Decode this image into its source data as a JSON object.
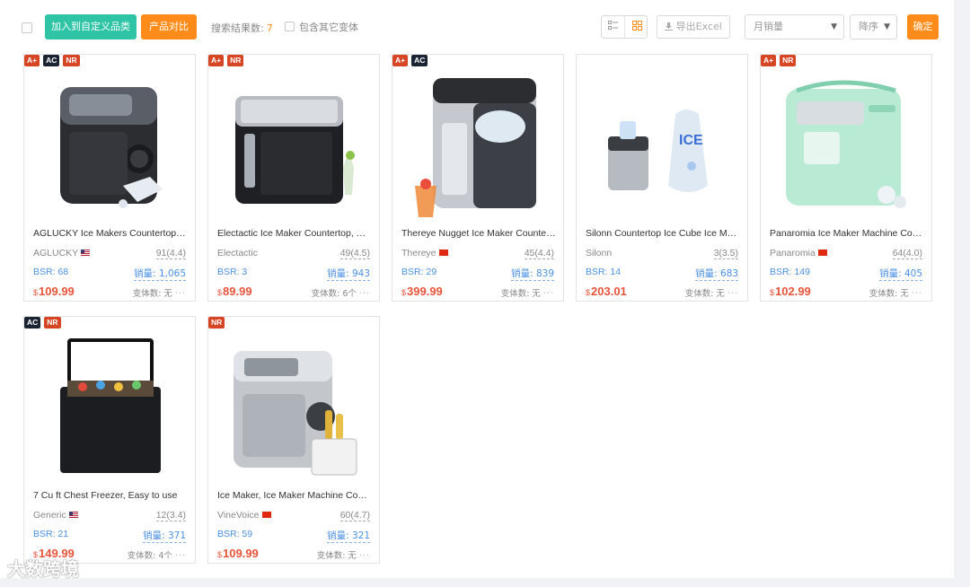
{
  "toolbar": {
    "add_category_label": "加入到自定义品类",
    "compare_label": "产品对比",
    "result_count_label": "搜索结果数:",
    "result_count": "7",
    "include_variants_label": "包含其它变体",
    "export_label": "导出Excel",
    "sort_field": "月销量",
    "sort_order": "降序",
    "confirm_label": "确定"
  },
  "products": [
    {
      "badges": [
        "A+",
        "AC",
        "NR"
      ],
      "title": "AGLUCKY Ice Makers Countertop Portable Ice Machine",
      "brand": "AGLUCKY",
      "flag": "us",
      "rating": "91(4.4)",
      "bsr": "BSR: 68",
      "sales": "销量: 1,065",
      "currency": "$",
      "price": "109.99",
      "variants": "变体数: 无"
    },
    {
      "badges": [
        "A+",
        "NR"
      ],
      "title": "Electactic Ice Maker Countertop, Portable Ice Machine",
      "brand": "Electactic",
      "flag": "",
      "rating": "49(4.5)",
      "bsr": "BSR: 3",
      "sales": "销量: 943",
      "currency": "$",
      "price": "89.99",
      "variants": "变体数: 6个"
    },
    {
      "badges": [
        "A+",
        "AC"
      ],
      "title": "Thereye Nugget Ice Maker Countertop",
      "brand": "Thereye",
      "flag": "cn",
      "rating": "45(4.4)",
      "bsr": "BSR: 29",
      "sales": "销量: 839",
      "currency": "$",
      "price": "399.99",
      "variants": "变体数: 无"
    },
    {
      "badges": [],
      "title": "Silonn Countertop Ice Cube Ice Maker",
      "brand": "Silonn",
      "flag": "",
      "rating": "3(3.5)",
      "bsr": "BSR: 14",
      "sales": "销量: 683",
      "currency": "$",
      "price": "203.01",
      "variants": "变体数: 无"
    },
    {
      "badges": [
        "A+",
        "NR"
      ],
      "title": "Panaromia Ice Maker Machine Countertop",
      "brand": "Panaromia",
      "flag": "cn",
      "rating": "64(4.0)",
      "bsr": "BSR: 149",
      "sales": "销量: 405",
      "currency": "$",
      "price": "102.99",
      "variants": "变体数: 无"
    },
    {
      "badges": [
        "AC",
        "NR"
      ],
      "title": "7 Cu ft Chest Freezer, Easy to use",
      "brand": "Generic",
      "flag": "us",
      "rating": "12(3.4)",
      "bsr": "BSR: 21",
      "sales": "销量: 371",
      "currency": "$",
      "price": "149.99",
      "variants": "变体数: 4个"
    },
    {
      "badges": [
        "NR"
      ],
      "title": "Ice Maker, Ice Maker Machine Countertop",
      "brand": "VineVoice",
      "flag": "cn",
      "rating": "60(4.7)",
      "bsr": "BSR: 59",
      "sales": "销量: 321",
      "currency": "$",
      "price": "109.99",
      "variants": "变体数: 无"
    }
  ],
  "watermark": "大数跨境"
}
